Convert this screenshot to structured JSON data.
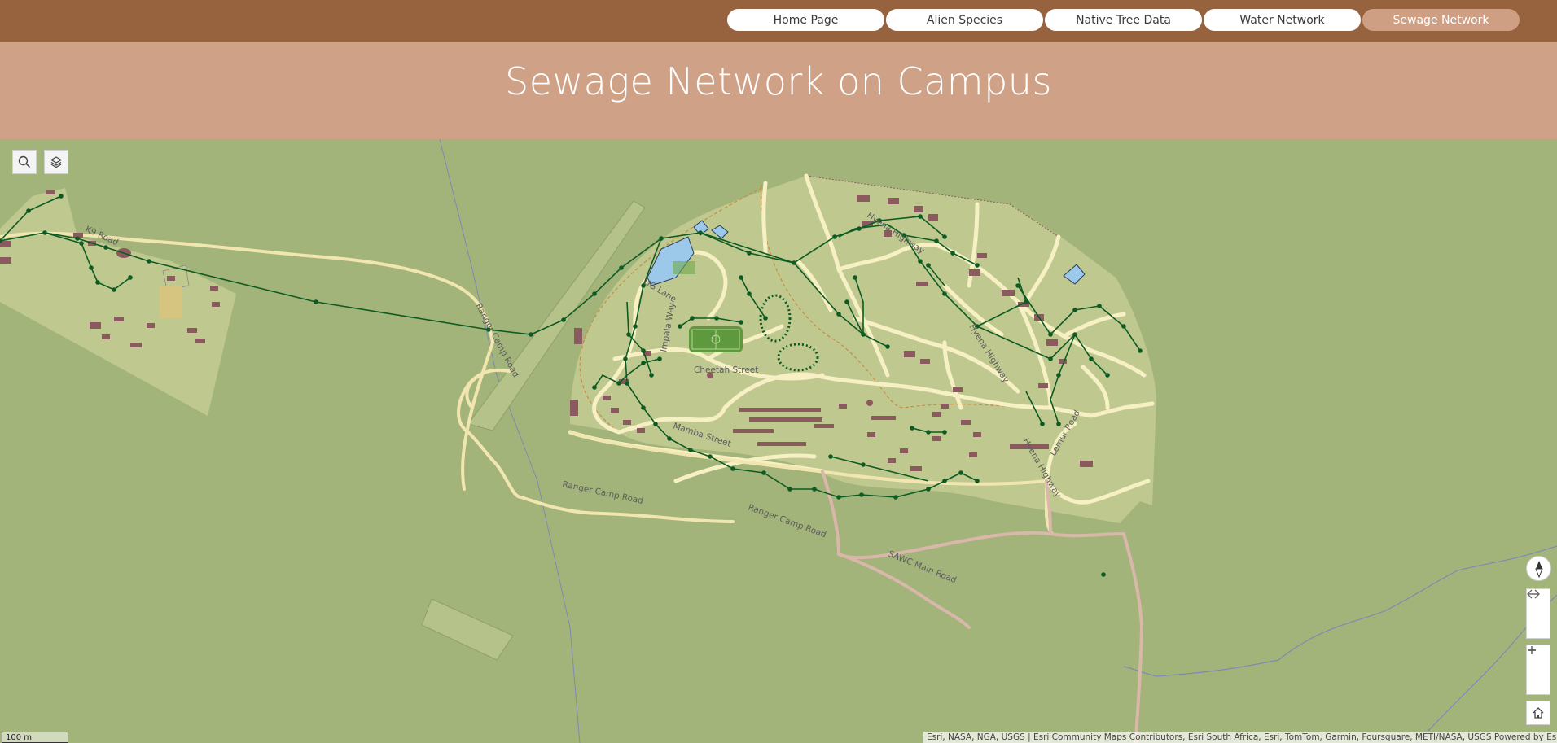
{
  "nav": {
    "items": [
      "Home Page",
      "Alien Species",
      "Native Tree Data",
      "Water Network",
      "Sewage Network"
    ],
    "active": "Sewage Network"
  },
  "banner": {
    "title": "Sewage Network on Campus"
  },
  "map": {
    "tools": {
      "search": "search-icon",
      "layers": "layers-icon"
    },
    "road_labels": {
      "cheetah": "Cheetah Street",
      "hyena_1": "Hyena Highway",
      "hyena_2": "Hyena Highway",
      "hyena_3": "Hyena Highway",
      "lemur": "Lemur Road",
      "mamba": "Mamba Street",
      "ranger_1": "Ranger Camp Road",
      "ranger_2": "Ranger Camp Road",
      "ranger_3": "Ranger Camp Road",
      "sawc": "SAWC Main Road",
      "ug": "UG Lane",
      "k9": "K9 Road",
      "impala": "Impala Way"
    },
    "scale_label": "100 m",
    "attribution": "Esri, NASA, NGA, USGS | Esri Community Maps Contributors, Esri South Africa, Esri, TomTom, Garmin, Foursquare, METI/NASA, USGS   Powered by Esri",
    "colors": {
      "background": "#a3b47a",
      "campus": "#bfc98f",
      "road": "#f7f0c4",
      "pipe": "#0d5a22",
      "building": "#8a5a5e",
      "water": "#9cc8ea"
    }
  }
}
